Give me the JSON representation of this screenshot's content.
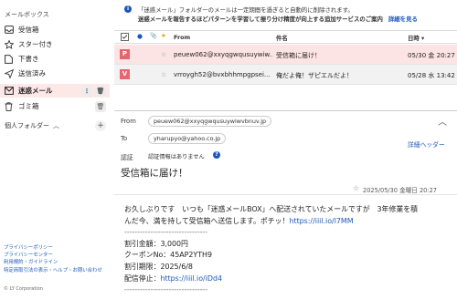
{
  "sidebar": {
    "section_title": "メールボックス",
    "items": [
      {
        "label": "受信箱",
        "icon": "inbox-icon"
      },
      {
        "label": "スター付き",
        "icon": "star-icon"
      },
      {
        "label": "下書き",
        "icon": "draft-icon"
      },
      {
        "label": "送信済み",
        "icon": "sent-icon"
      },
      {
        "label": "迷惑メール",
        "icon": "spam-icon"
      },
      {
        "label": "ゴミ箱",
        "icon": "trash-icon"
      }
    ],
    "personal_folders": "個人フォルダー",
    "footer_links": [
      "プライバシーポリシー",
      "プライバシーセンター",
      "利用規約・ガイドライン",
      "特定商取引法の表示・ヘルプ・お問い合わせ"
    ],
    "copyright": "© LY Corporation"
  },
  "notice": {
    "line1": "「迷惑メール」フォルダーのメールは一定期間を過ぎると自動的に削除されます。",
    "line2": "迷惑メールを報告するほどパターンを学習して振り分け精度が向上する追加サービスのご案内",
    "link": "詳細を見る"
  },
  "list": {
    "headers": {
      "from": "From",
      "subject": "件名",
      "date": "日時"
    },
    "rows": [
      {
        "avatar": "P",
        "from": "peuew062@xxyqgwqusuywiw...",
        "subject": "受信箱に届け！",
        "date": "05/30 金 20:27"
      },
      {
        "avatar": "V",
        "from": "vrroygh52@bvxbhhmpgpsei...",
        "subject": "俺だよ俺！ザピエルだよ！",
        "date": "05/28 水 13:42"
      }
    ]
  },
  "detail": {
    "from_label": "From",
    "from": "peuew062@xxyqgwqusuywiwvbnuv.jp",
    "to_label": "To",
    "to": "yharupyo@yahoo.co.jp",
    "auth_label": "認証",
    "auth_value": "認証情報はありません",
    "header_link": "詳細ヘッダー",
    "subject": "受信箱に届け！",
    "date": "2025/05/30 金曜日 20:27",
    "body": [
      "お久しぶりです　いつも「迷惑メールBOX」へ配送されていたメールですが　3年修業を積",
      "んだ今、満を持して受信箱へ送信します。ポチッ！",
      "--------------------------------",
      "割引金額：3,000円",
      "クーポンNo：45AP2YTH9",
      "割引期限：2025/6/8",
      "配信停止：",
      "--------------------------------"
    ],
    "link1": "https://iiil.io/l7MM",
    "link2": "https://iiil.io/iDd4"
  },
  "colors": {
    "accent": "#1a57b8",
    "selected_row": "#fde4e4",
    "spam_highlight": "#fde8e8",
    "avatar_red": "#e8646e"
  }
}
